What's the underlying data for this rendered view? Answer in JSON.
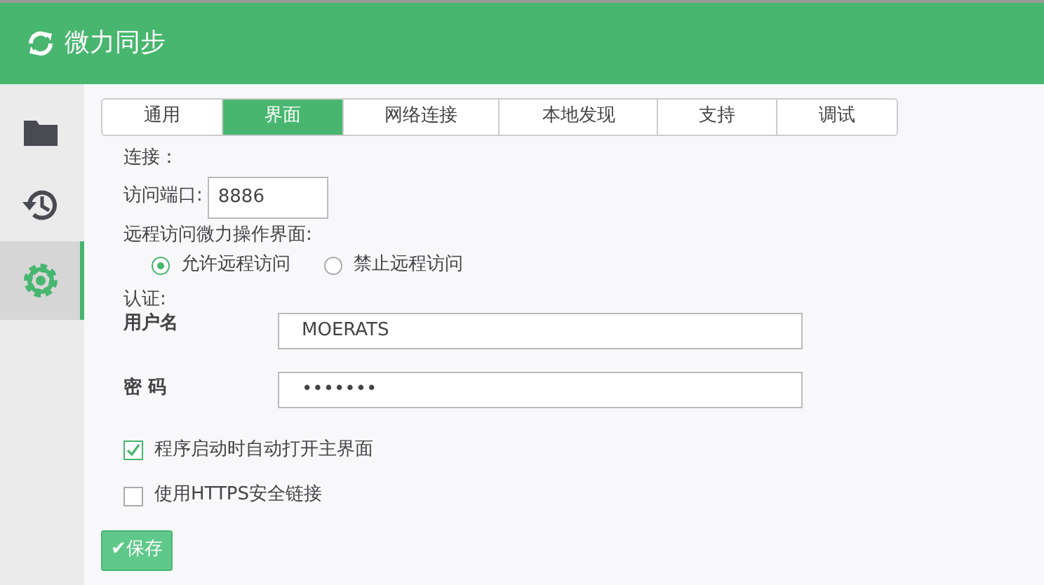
{
  "app": {
    "title": "微力同步"
  },
  "sidebar": {
    "items": [
      {
        "kind": "folder",
        "selected": false
      },
      {
        "kind": "history",
        "selected": false
      },
      {
        "kind": "settings",
        "selected": true
      }
    ]
  },
  "tabs": [
    {
      "label": "通用",
      "selected": false
    },
    {
      "label": "界面",
      "selected": true
    },
    {
      "label": "网络连接",
      "selected": false
    },
    {
      "label": "本地发现",
      "selected": false
    },
    {
      "label": "支持",
      "selected": false
    },
    {
      "label": "调试",
      "selected": false
    }
  ],
  "connection": {
    "heading": "连接：",
    "port_label": "访问端口:",
    "port_value": "8886"
  },
  "remote": {
    "heading": "远程访问微力操作界面:",
    "options": [
      {
        "label": "允许远程访问",
        "selected": true
      },
      {
        "label": "禁止远程访问",
        "selected": false
      }
    ]
  },
  "auth": {
    "heading": "认证:",
    "username_label": "用户名",
    "username_value": "MOERATS",
    "password_label": "密 码",
    "password_value": "•••••••"
  },
  "options": [
    {
      "label": "程序启动时自动打开主界面",
      "checked": true
    },
    {
      "label": "使用HTTPS安全链接",
      "checked": false
    }
  ],
  "save_button": {
    "icon": "✔",
    "label": "保存"
  }
}
